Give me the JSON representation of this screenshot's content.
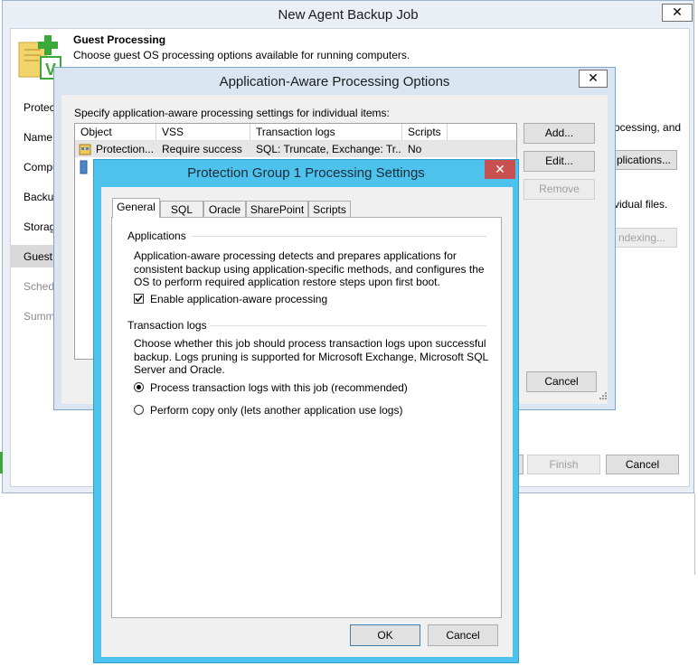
{
  "main_window": {
    "title": "New Agent Backup Job",
    "close_glyph": "✕",
    "header_title": "Guest Processing",
    "header_desc": "Choose guest OS processing options available for running computers.",
    "steps": [
      "Protect",
      "Name",
      "Compu",
      "Backup",
      "Storage",
      "Guest P",
      "Schedu",
      "Summ"
    ],
    "right_text_1": "ocessing, and",
    "right_btn_applications": "plications...",
    "right_text_2": "vidual files.",
    "right_btn_indexing": "ndexing...",
    "finish_label": "Finish",
    "cancel_label": "Cancel"
  },
  "aap_dialog": {
    "title": "Application-Aware Processing Options",
    "close_glyph": "✕",
    "instruction": "Specify application-aware processing settings for individual items:",
    "columns": [
      "Object",
      "VSS",
      "Transaction logs",
      "Scripts"
    ],
    "rows": [
      {
        "object": "Protection...",
        "vss": "Require success",
        "tlogs": "SQL: Truncate, Exchange: Tr...",
        "scripts": "No"
      }
    ],
    "add_label": "Add...",
    "edit_label": "Edit...",
    "remove_label": "Remove",
    "cancel_label": "Cancel"
  },
  "pg_dialog": {
    "title": "Protection Group 1 Processing Settings",
    "close_glyph": "✕",
    "tabs": [
      "General",
      "SQL",
      "Oracle",
      "SharePoint",
      "Scripts"
    ],
    "applications_heading": "Applications",
    "applications_desc": "Application-aware processing detects and prepares applications for consistent backup using application-specific methods, and configures the OS to perform required application restore steps upon first boot.",
    "enable_aap_label": "Enable application-aware processing",
    "enable_aap_checked": true,
    "tlogs_heading": "Transaction logs",
    "tlogs_desc": "Choose whether this job should process transaction logs upon successful backup. Logs pruning is supported for Microsoft Exchange, Microsoft SQL Server and Oracle.",
    "radio_process_label": "Process transaction logs with this job (recommended)",
    "radio_copy_label": "Perform copy only (lets another application use logs)",
    "selected_option": "process",
    "ok_label": "OK",
    "cancel_label": "Cancel"
  },
  "colors": {
    "dialog_border": "#7fa6c9",
    "pg_border": "#3ab2e6",
    "close_red": "#c75050",
    "selected_step_bg": "#d9d9d9"
  }
}
